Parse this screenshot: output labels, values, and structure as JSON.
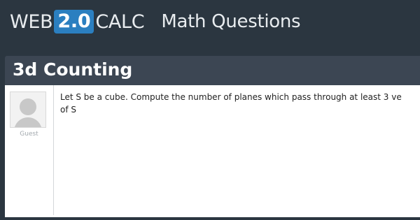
{
  "brand": {
    "prefix": "WEB",
    "version": "2.0",
    "suffix": "CALC",
    "tagline": "Math Questions"
  },
  "page": {
    "title": "3d Counting"
  },
  "post": {
    "author": "Guest",
    "line1": "Let S be a cube. Compute the number of planes which pass through at least 3 ve",
    "line2": "of S"
  },
  "colors": {
    "background": "#2b3640",
    "title_bar": "#3c4653",
    "version_badge": "#2b7fc0"
  },
  "icons": {
    "avatar": "user-avatar-icon"
  }
}
